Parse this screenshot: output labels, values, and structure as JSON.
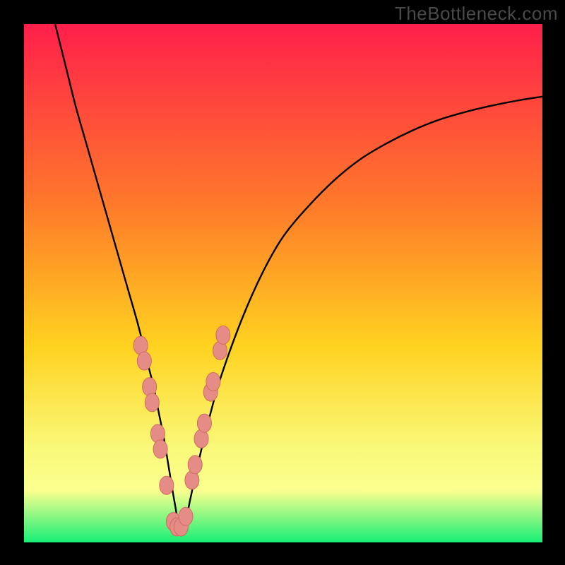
{
  "watermark": "TheBottleneck.com",
  "colors": {
    "frame": "#000000",
    "gradient_top": "#ff1f4b",
    "gradient_mid1": "#ff7a2a",
    "gradient_mid2": "#ffd21f",
    "gradient_mid3": "#f9f97a",
    "gradient_band": "#fbff8e",
    "gradient_bottom": "#17ef76",
    "curve": "#000000",
    "marker_fill": "#e58c86",
    "marker_stroke": "#cf6b63"
  },
  "chart_data": {
    "type": "line",
    "title": "",
    "xlabel": "",
    "ylabel": "",
    "xlim": [
      0,
      100
    ],
    "ylim": [
      0,
      100
    ],
    "series": [
      {
        "name": "bottleneck-curve",
        "x": [
          6,
          8,
          10,
          12,
          14,
          16,
          18,
          20,
          22,
          24,
          25,
          26,
          27,
          28,
          29,
          30,
          31,
          32,
          34,
          36,
          38,
          42,
          46,
          50,
          55,
          60,
          65,
          70,
          75,
          80,
          85,
          90,
          95,
          100
        ],
        "values": [
          100,
          92,
          84,
          77,
          70,
          63,
          56,
          49,
          42,
          34,
          30,
          25,
          20,
          14,
          8,
          3,
          3,
          8,
          17,
          25,
          32,
          43,
          52,
          59,
          65,
          70,
          74,
          77,
          79.5,
          81.5,
          83,
          84.2,
          85.2,
          86
        ]
      }
    ],
    "markers": {
      "name": "highlighted-points",
      "x": [
        22.5,
        23.2,
        24.2,
        24.7,
        25.8,
        26.3,
        27.5,
        28.8,
        29.5,
        30.3,
        31.2,
        32.4,
        33.0,
        34.2,
        34.8,
        36.0,
        36.5,
        37.8,
        38.4
      ],
      "values": [
        38,
        35,
        30,
        27,
        21,
        18,
        11,
        4,
        3,
        3,
        5,
        12,
        15,
        20,
        23,
        29,
        31,
        37,
        40
      ]
    }
  }
}
